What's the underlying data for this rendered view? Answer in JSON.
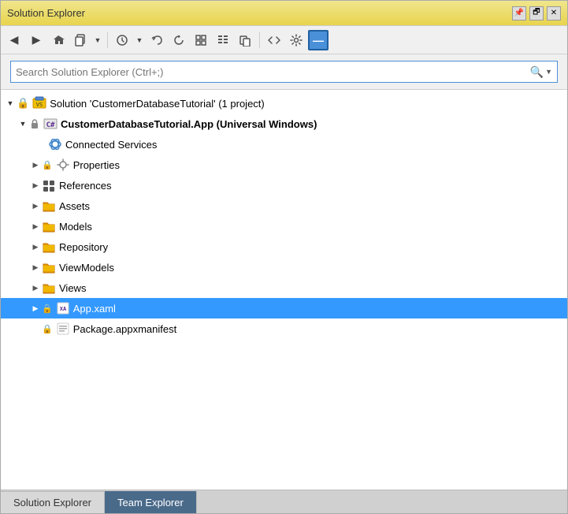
{
  "window": {
    "title": "Solution Explorer"
  },
  "titlebar": {
    "title": "Solution Explorer",
    "pin_label": "📌",
    "restore_label": "🗗",
    "close_label": "✕"
  },
  "toolbar": {
    "back_label": "◀",
    "forward_label": "▶",
    "home_label": "⌂",
    "copy_label": "📋",
    "history_label": "🕐",
    "undo_label": "↩",
    "refresh_label": "↻",
    "collapse_label": "⊟",
    "filter_label": "▤",
    "copy2_label": "⎘",
    "code_label": "<>",
    "settings_label": "🔧",
    "active_label": "—"
  },
  "search": {
    "placeholder": "Search Solution Explorer (Ctrl+;)"
  },
  "tree": {
    "solution_label": "Solution 'CustomerDatabaseTutorial' (1 project)",
    "project_label": "CustomerDatabaseTutorial.App (Universal Windows)",
    "items": [
      {
        "id": "connected-services",
        "label": "Connected Services",
        "icon": "cloud",
        "indent": 2,
        "expandable": false
      },
      {
        "id": "properties",
        "label": "Properties",
        "icon": "properties",
        "indent": 2,
        "expandable": true
      },
      {
        "id": "references",
        "label": "References",
        "icon": "references",
        "indent": 2,
        "expandable": true
      },
      {
        "id": "assets",
        "label": "Assets",
        "icon": "folder",
        "indent": 2,
        "expandable": true
      },
      {
        "id": "models",
        "label": "Models",
        "icon": "folder",
        "indent": 2,
        "expandable": true
      },
      {
        "id": "repository",
        "label": "Repository",
        "icon": "folder",
        "indent": 2,
        "expandable": true
      },
      {
        "id": "viewmodels",
        "label": "ViewModels",
        "icon": "folder",
        "indent": 2,
        "expandable": true
      },
      {
        "id": "views",
        "label": "Views",
        "icon": "folder",
        "indent": 2,
        "expandable": true
      },
      {
        "id": "appxaml",
        "label": "App.xaml",
        "icon": "xaml",
        "indent": 2,
        "expandable": true,
        "selected": true
      },
      {
        "id": "packagemanifest",
        "label": "Package.appxmanifest",
        "icon": "manifest",
        "indent": 2,
        "expandable": false
      }
    ]
  },
  "bottom_tabs": [
    {
      "id": "solution-explorer",
      "label": "Solution Explorer",
      "active": false
    },
    {
      "id": "team-explorer",
      "label": "Team Explorer",
      "active": true
    }
  ]
}
